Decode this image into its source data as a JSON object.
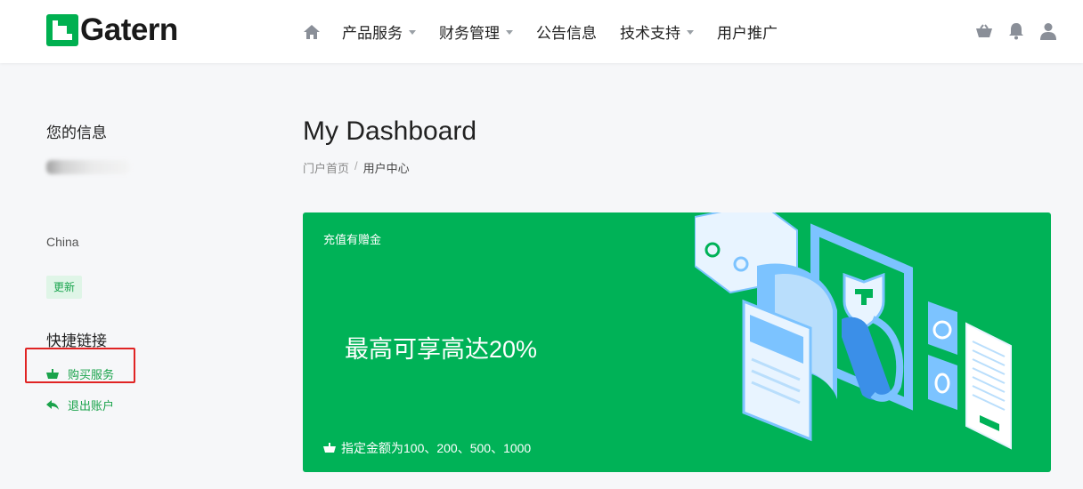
{
  "header": {
    "logo_text": "Gatern",
    "nav": [
      {
        "label": "产品服务",
        "has_dropdown": true
      },
      {
        "label": "财务管理",
        "has_dropdown": true
      },
      {
        "label": "公告信息",
        "has_dropdown": false
      },
      {
        "label": "技术支持",
        "has_dropdown": true
      },
      {
        "label": "用户推广",
        "has_dropdown": false
      }
    ],
    "icons": [
      "home-icon",
      "basket-icon",
      "bell-icon",
      "user-icon"
    ]
  },
  "sidebar": {
    "info_title": "您的信息",
    "country": "China",
    "update_label": "更新",
    "quick_links_title": "快捷链接",
    "links": [
      {
        "label": "购买服务",
        "icon": "basket-icon"
      },
      {
        "label": "退出账户",
        "icon": "back-arrow-icon"
      }
    ]
  },
  "main": {
    "title": "My Dashboard",
    "breadcrumb": [
      {
        "label": "门户首页"
      },
      {
        "label": "用户中心"
      }
    ],
    "breadcrumb_sep": "/",
    "banner": {
      "tag": "充值有赠金",
      "headline": "最高可享高达20%",
      "footnote": "指定金额为100、200、500、1000",
      "color": "#00b257"
    }
  },
  "colors": {
    "accent": "#00b050",
    "link": "#1aa34b",
    "highlight": "#e02424"
  }
}
